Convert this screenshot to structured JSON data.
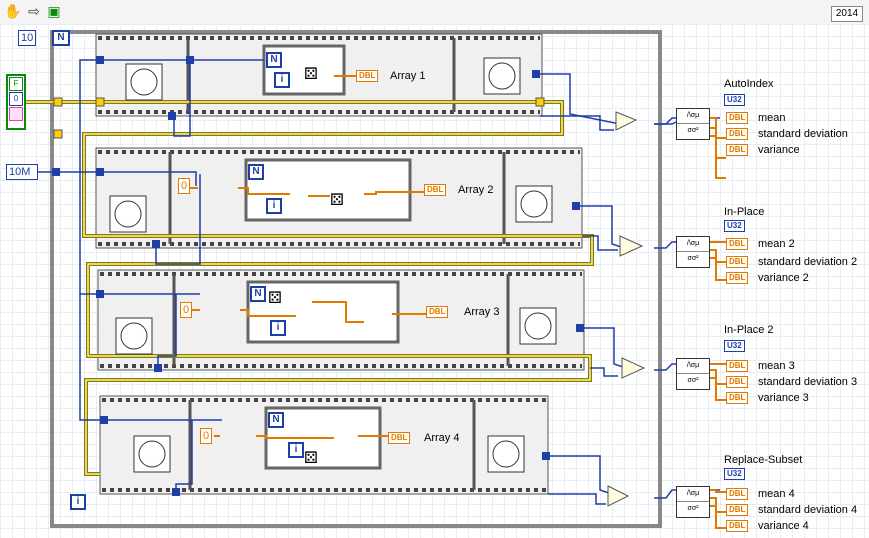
{
  "toolbar": {
    "icons": [
      "hand-icon",
      "run-arrow-icon",
      "abort-icon"
    ],
    "year": "2014"
  },
  "constants": {
    "iterations": "10",
    "array_size": "10M",
    "init_value_1": "0",
    "init_value_2": "0",
    "init_value_3": "0",
    "control_bool": "F",
    "control_num": "0"
  },
  "loop_labels": {
    "for_loop": "N",
    "iteration": "i"
  },
  "indicator_types": {
    "dbl": "DBL",
    "u32": "U32"
  },
  "stats_icon": {
    "top": "/\\σμ",
    "bottom": "σσ²"
  },
  "arrays": [
    "Array 1",
    "Array 2",
    "Array 3",
    "Array 4"
  ],
  "groups": [
    {
      "title": "AutoIndex",
      "mean": "mean",
      "sd": "standard deviation",
      "var": "variance"
    },
    {
      "title": "In-Place",
      "mean": "mean 2",
      "sd": "standard deviation 2",
      "var": "variance 2"
    },
    {
      "title": "In-Place 2",
      "mean": "mean 3",
      "sd": "standard deviation 3",
      "var": "variance 3"
    },
    {
      "title": "Replace-Subset",
      "mean": "mean 4",
      "sd": "standard deviation 4",
      "var": "variance 4"
    }
  ],
  "colors": {
    "wire_int": "#1f3fa8",
    "wire_dbl": "#e07b00",
    "wire_err": "#8a7a00",
    "frame": "#d8d8d8"
  }
}
